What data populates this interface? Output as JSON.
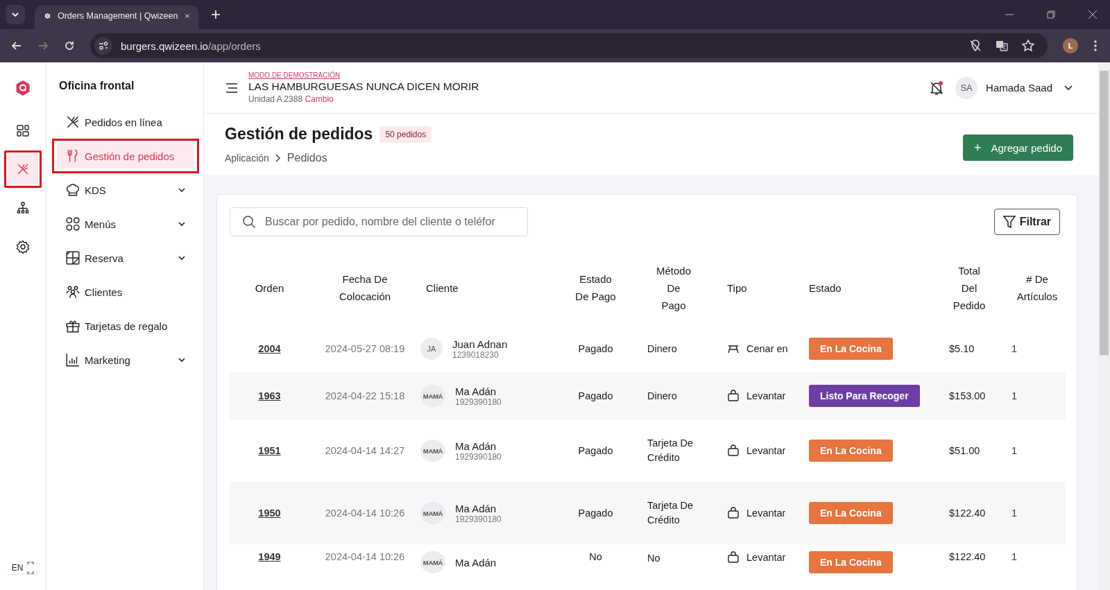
{
  "browser": {
    "tab_title": "Orders Management | Qwizeen",
    "url_host": "burgers.qwizeen.io",
    "url_path": "/app/orders",
    "profile_initial": "L"
  },
  "rail": {
    "items": [
      {
        "kind": "dashboard",
        "selected": false,
        "annotated": false
      },
      {
        "kind": "orders",
        "selected": true,
        "annotated": true
      },
      {
        "kind": "hierarchy",
        "selected": false,
        "annotated": false
      },
      {
        "kind": "settings",
        "selected": false,
        "annotated": false
      }
    ],
    "language": "EN"
  },
  "nav": {
    "title": "Oficina frontal",
    "items": [
      {
        "label": "Pedidos en línea",
        "selected": false,
        "expandable": false,
        "annotated": false
      },
      {
        "label": "Gestión de pedidos",
        "selected": true,
        "expandable": false,
        "annotated": true
      },
      {
        "label": "KDS",
        "selected": false,
        "expandable": true,
        "annotated": false
      },
      {
        "label": "Menús",
        "selected": false,
        "expandable": true,
        "annotated": false
      },
      {
        "label": "Reserva",
        "selected": false,
        "expandable": true,
        "annotated": false
      },
      {
        "label": "Clientes",
        "selected": false,
        "expandable": false,
        "annotated": false
      },
      {
        "label": "Tarjetas de regalo",
        "selected": false,
        "expandable": false,
        "annotated": false
      },
      {
        "label": "Marketing",
        "selected": false,
        "expandable": true,
        "annotated": false
      }
    ]
  },
  "header": {
    "demo_label": "MODO DE DEMOSTRACIÓN",
    "restaurant": "LAS HAMBURGUESAS NUNCA DICEN MORIR",
    "unit": "Unidad A 2388",
    "change_link": "Cambio",
    "user_initials": "SA",
    "user_name": "Hamada Saad"
  },
  "page": {
    "title": "Gestión de pedidos",
    "count_badge": "50 pedidos",
    "breadcrumb": [
      "Aplicación",
      "Pedidos"
    ],
    "add_button": "Agregar pedido",
    "add_icon": "+"
  },
  "search": {
    "placeholder": "Buscar por pedido, nombre del cliente o teléfor"
  },
  "filter_button": "Filtrar",
  "table": {
    "columns": [
      "Orden",
      "Fecha De Colocación",
      "Cliente",
      "Estado De Pago",
      "Método De Pago",
      "Tipo",
      "Estado",
      "Total Del Pedido",
      "# De Artículos"
    ],
    "rows": [
      {
        "order": "2004",
        "date": "2024-05-27 08:19",
        "initials": "JA",
        "customer": "Juan Adnan",
        "phone": "1239018230",
        "payment_status": "Pagado",
        "payment_method": "Dinero",
        "type": "Cenar en",
        "kind": "dine-in",
        "status": "En La Cocina",
        "color": "#e8743f",
        "total": "$5.10",
        "items": "1"
      },
      {
        "order": "1963",
        "date": "2024-04-22 15:18",
        "initials": "MAMÁ",
        "customer": "Ma Adán",
        "phone": "1929390180",
        "payment_status": "Pagado",
        "payment_method": "Dinero",
        "type": "Levantar",
        "kind": "pickup",
        "status": "Listo Para Recoger",
        "color": "#6d3fa6",
        "total": "$153.00",
        "items": "1"
      },
      {
        "order": "1951",
        "date": "2024-04-14 14:27",
        "initials": "MAMÁ",
        "customer": "Ma Adán",
        "phone": "1929390180",
        "payment_status": "Pagado",
        "payment_method": "Tarjeta De Crédito",
        "type": "Levantar",
        "kind": "pickup",
        "status": "En La Cocina",
        "color": "#e8743f",
        "total": "$51.00",
        "items": "1"
      },
      {
        "order": "1950",
        "date": "2024-04-14 10:26",
        "initials": "MAMÁ",
        "customer": "Ma Adán",
        "phone": "1929390180",
        "payment_status": "Pagado",
        "payment_method": "Tarjeta De Crédito",
        "type": "Levantar",
        "kind": "pickup",
        "status": "En La Cocina",
        "color": "#e8743f",
        "total": "$122.40",
        "items": "1"
      },
      {
        "order": "1949",
        "date": "2024-04-14 10:26",
        "initials": "MAMÁ",
        "customer": "Ma Adán",
        "payment_status": "No",
        "payment_method": "No",
        "type": "Levantar",
        "kind": "pickup",
        "status": "En La Cocina",
        "color": "#e8743f",
        "total": "$122.40",
        "items": "1"
      }
    ]
  }
}
